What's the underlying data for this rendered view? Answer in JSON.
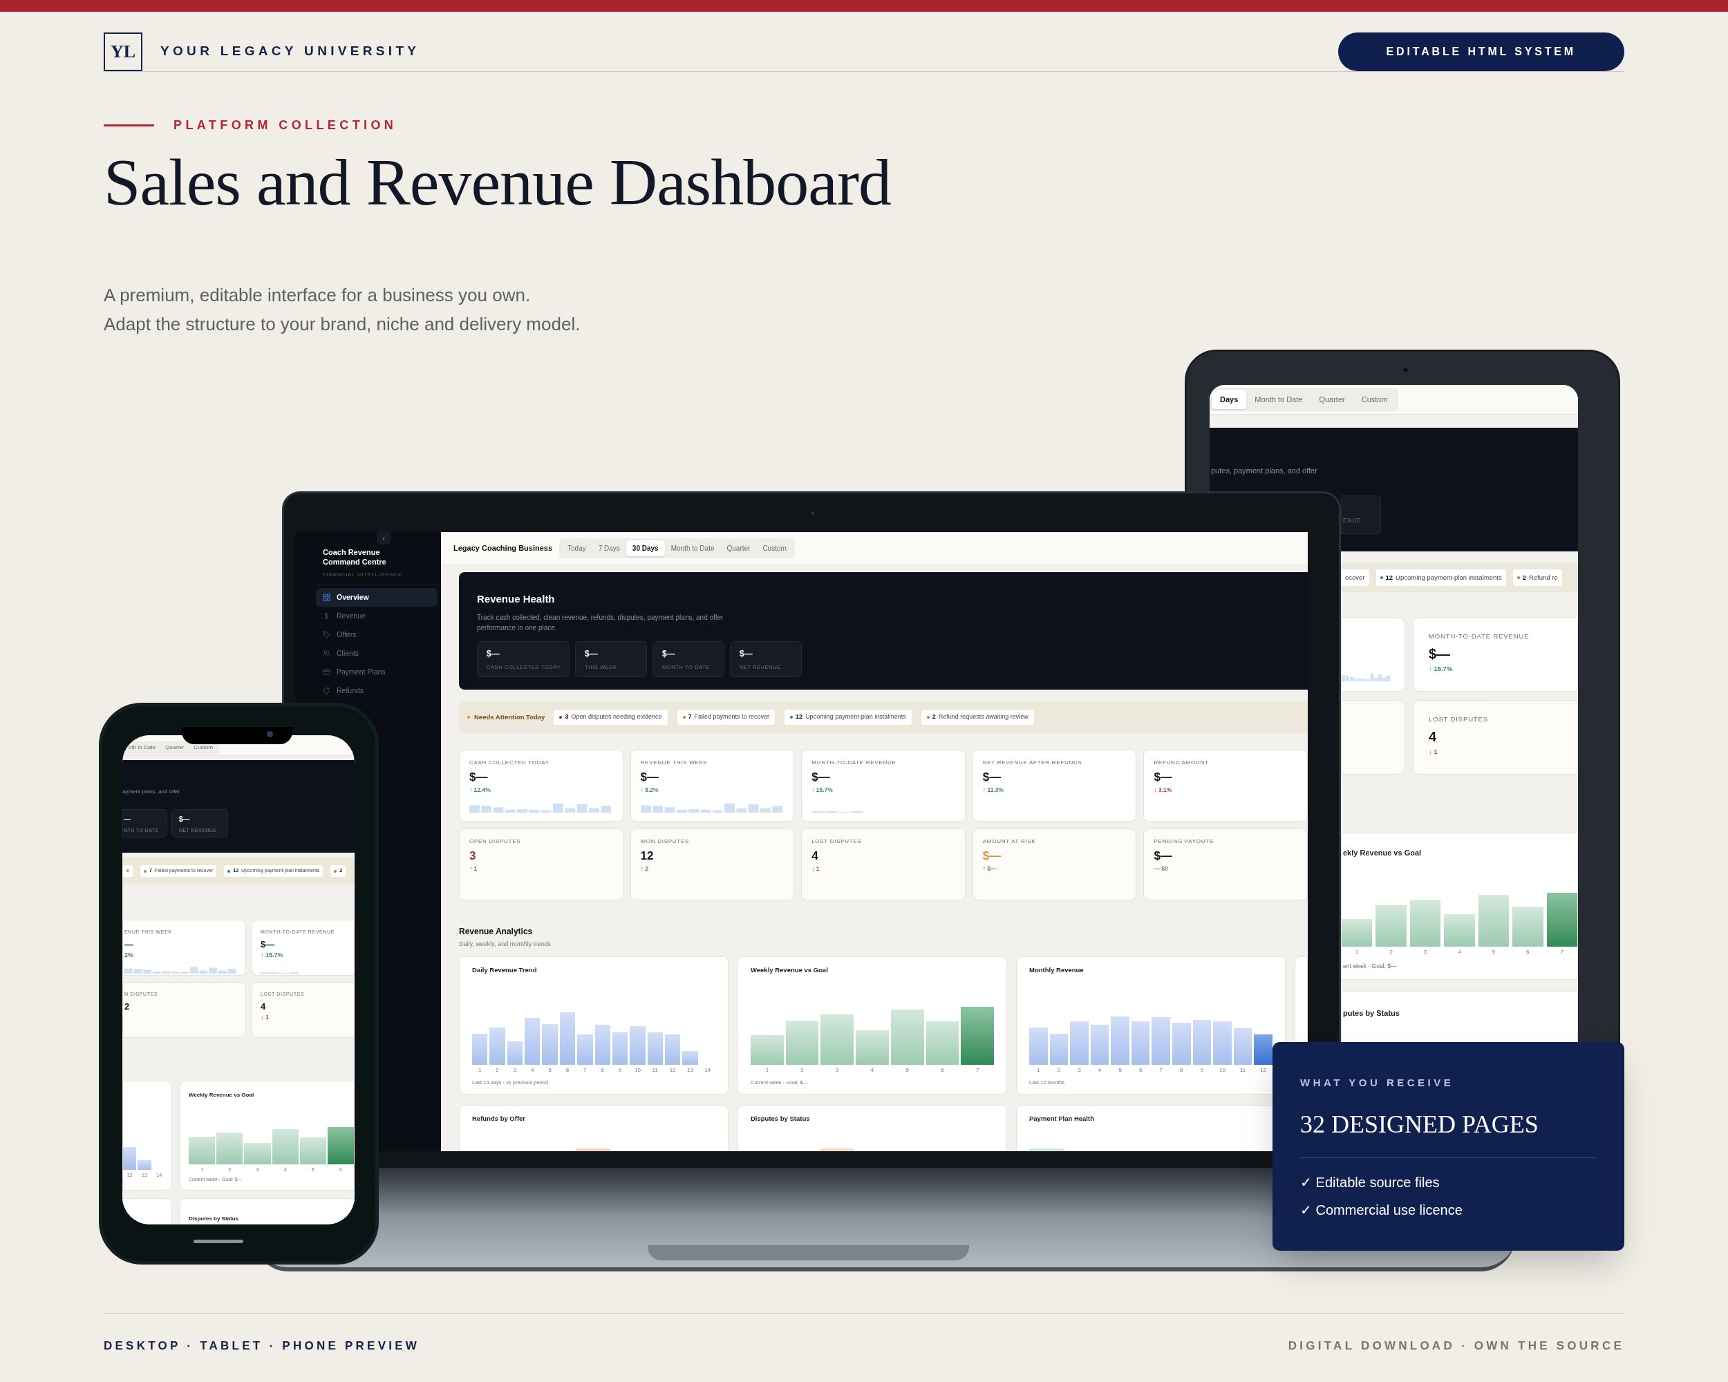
{
  "brand": {
    "logo": "YL",
    "name": "YOUR LEGACY UNIVERSITY",
    "cta": "EDITABLE HTML SYSTEM"
  },
  "intro": {
    "eyebrow": "PLATFORM COLLECTION",
    "title": "Sales and Revenue Dashboard",
    "lines": [
      "A premium, editable interface for a business you own.",
      "Adapt the structure to your brand, niche and delivery model."
    ]
  },
  "laptop": {
    "sidebar": {
      "title": "Coach Revenue Command Centre",
      "subtitle": "FINANCIAL INTELLIGENCE",
      "items": [
        {
          "label": "Overview",
          "selected": true
        },
        {
          "label": "Revenue",
          "selected": false
        },
        {
          "label": "Offers",
          "selected": false
        },
        {
          "label": "Clients",
          "selected": false
        },
        {
          "label": "Payment Plans",
          "selected": false
        },
        {
          "label": "Refunds",
          "selected": false
        }
      ]
    },
    "business": "Legacy Coaching Business",
    "ranges": [
      {
        "label": "Today",
        "selected": false
      },
      {
        "label": "7 Days",
        "selected": false
      },
      {
        "label": "30 Days",
        "selected": true
      },
      {
        "label": "Month to Date",
        "selected": false
      },
      {
        "label": "Quarter",
        "selected": false
      },
      {
        "label": "Custom",
        "selected": false
      }
    ],
    "health": {
      "title": "Revenue Health",
      "description": "Track cash collected, clean revenue, refunds, disputes, payment plans, and offer performance in one place.",
      "stats": [
        {
          "value": "$—",
          "label": "CASH COLLECTED TODAY"
        },
        {
          "value": "$—",
          "label": "THIS WEEK"
        },
        {
          "value": "$—",
          "label": "MONTH TO DATE"
        },
        {
          "value": "$—",
          "label": "NET REVENUE"
        }
      ]
    },
    "attention": {
      "label": "Needs Attention Today",
      "color": "#c59b3f",
      "items": [
        {
          "count": "3",
          "text": "Open disputes needing evidence",
          "color": "#9b2c2c"
        },
        {
          "count": "7",
          "text": "Failed payments to recover",
          "color": "#c0872f"
        },
        {
          "count": "12",
          "text": "Upcoming payment-plan instalments",
          "color": "#2f6fd0"
        },
        {
          "count": "2",
          "text": "Refund requests awaiting review",
          "color": "#a08a2a"
        }
      ]
    },
    "metrics": [
      {
        "kind": "bars",
        "label": "CASH COLLECTED TODAY",
        "value": {
          "text": "$—",
          "color": "#15171a"
        },
        "change": {
          "text": "↑ 12.4%",
          "color": "#3d8b62"
        }
      },
      {
        "kind": "bars",
        "label": "REVENUE THIS WEEK",
        "value": {
          "text": "$—",
          "color": "#15171a"
        },
        "change": {
          "text": "↑ 8.2%",
          "color": "#3d8b62"
        }
      },
      {
        "kind": "dashes",
        "label": "MONTH-TO-DATE REVENUE",
        "value": {
          "text": "$—",
          "color": "#15171a"
        },
        "change": {
          "text": "↑ 15.7%",
          "color": "#3d8b62"
        }
      },
      {
        "kind": "plain",
        "label": "NET REVENUE AFTER REFUNDS",
        "value": {
          "text": "$—",
          "color": "#15171a"
        },
        "change": {
          "text": "↑ 11.3%",
          "color": "#3d8b62"
        }
      },
      {
        "kind": "plain",
        "label": "REFUND AMOUNT",
        "value": {
          "text": "$—",
          "color": "#15171a"
        },
        "change": {
          "text": "↓ 3.1%",
          "color": "#b3453f"
        }
      },
      {
        "kind": "plain",
        "label": "OPEN DISPUTES",
        "value": {
          "text": "3",
          "color": "#a8322b"
        },
        "change": {
          "text": "↑ 1",
          "color": "#3d8b62"
        }
      },
      {
        "kind": "plain",
        "label": "WON DISPUTES",
        "value": {
          "text": "12",
          "color": "#15171a"
        },
        "change": {
          "text": "↑ 2",
          "color": "#3d8b62"
        }
      },
      {
        "kind": "plain",
        "label": "LOST DISPUTES",
        "value": {
          "text": "4",
          "color": "#15171a"
        },
        "change": {
          "text": "↓ 1",
          "color": "#b3453f"
        }
      },
      {
        "kind": "plain",
        "label": "AMOUNT AT RISK",
        "value": {
          "text": "$—",
          "color": "#c99a45"
        },
        "change": {
          "text": "↑ $—",
          "color": "#3d8b62"
        }
      },
      {
        "kind": "plain",
        "label": "PENDING PAYOUTS",
        "value": {
          "text": "$—",
          "color": "#15171a"
        },
        "change": {
          "text": "— $0",
          "color": "#7a7a7a"
        }
      }
    ],
    "analytics": {
      "title": "Revenue Analytics",
      "subtitle": "Daily, weekly, and monthly trends",
      "charts": [
        {
          "kind": "daily",
          "title": "Daily Revenue Trend",
          "x_labels": [
            "1",
            "2",
            "3",
            "4",
            "5",
            "6",
            "7",
            "8",
            "9",
            "10",
            "11",
            "12",
            "13",
            "14"
          ],
          "caption": "Last 14 days · vs previous period"
        },
        {
          "kind": "weekly",
          "title": "Weekly Revenue vs Goal",
          "x_labels": [
            "1",
            "2",
            "3",
            "4",
            "5",
            "6",
            "7"
          ],
          "caption": "Current week · Goal: $—"
        },
        {
          "kind": "monthly",
          "title": "Monthly Revenue",
          "x_labels": [
            "1",
            "2",
            "3",
            "4",
            "5",
            "6",
            "7",
            "8",
            "9",
            "10",
            "11",
            "12"
          ],
          "caption": "Last 12 months"
        }
      ],
      "more": [
        "Refunds by Offer",
        "Disputes by Status",
        "Payment Plan Health"
      ]
    }
  },
  "tablet": {
    "ranges": [
      {
        "label": "Days",
        "selected": true
      },
      {
        "label": "Month to Date",
        "selected": false
      },
      {
        "label": "Quarter",
        "selected": false
      },
      {
        "label": "Custom",
        "selected": false
      }
    ],
    "description": "putes, payment plans, and offer",
    "stat_label": "ENUE",
    "attention": [
      {
        "text": "ecover"
      },
      {
        "count": "12",
        "text": "Upcoming payment-plan instalments",
        "color": "#2f6fd0"
      },
      {
        "count": "2",
        "text": "Refund re",
        "color": "#a08a2a"
      }
    ],
    "metrics": [
      {
        "kind": "dashes",
        "label": "MONTH-TO-DATE REVENUE",
        "value": {
          "text": "$—",
          "color": "#15171a"
        },
        "change": {
          "text": "↑ 15.7%",
          "color": "#3d8b62"
        }
      },
      {
        "kind": "plain",
        "label": "LOST DISPUTES",
        "value": {
          "text": "4",
          "color": "#15171a"
        },
        "change": {
          "text": "↓ 1",
          "color": "#b3453f"
        }
      }
    ],
    "chart": {
      "kind": "weekly",
      "title": "ekly Revenue vs Goal",
      "x_labels": [
        "1",
        "2",
        "3",
        "4",
        "5",
        "6",
        "7"
      ],
      "caption": "ent week · Goal: $—"
    },
    "more": "putes by Status"
  },
  "phone": {
    "ranges": [
      {
        "label": "nth to Date",
        "selected": false
      },
      {
        "label": "Quarter",
        "selected": false
      },
      {
        "label": "Custom",
        "selected": false
      }
    ],
    "description": "ayment plans, and offer",
    "stats": [
      {
        "value": "—",
        "label": "NTH TO DATE"
      },
      {
        "value": "$—",
        "label": "NET REVENUE"
      }
    ],
    "attention": [
      {
        "text": "e"
      },
      {
        "count": "7",
        "text": "Failed payments to recover",
        "color": "#c0872f"
      },
      {
        "count": "12",
        "text": "Upcoming payment-plan instalments",
        "color": "#2f6fd0"
      },
      {
        "count": "2",
        "color": "#a08a2a"
      }
    ],
    "metrics": [
      {
        "kind": "bars",
        "label": "ENUE THIS WEEK",
        "value": {
          "text": "—",
          "color": "#15171a"
        },
        "change": {
          "text": "2%",
          "color": "#3d8b62"
        }
      },
      {
        "kind": "dashes",
        "label": "MONTH-TO-DATE REVENUE",
        "value": {
          "text": "$—",
          "color": "#15171a"
        },
        "change": {
          "text": "↑ 15.7%",
          "color": "#3d8b62"
        }
      },
      {
        "kind": "plain",
        "label": "N DISPUTES",
        "value": {
          "text": "2",
          "color": "#15171a"
        }
      },
      {
        "kind": "plain",
        "label": "LOST DISPUTES",
        "value": {
          "text": "4",
          "color": "#15171a"
        },
        "change": {
          "text": "↓ 1",
          "color": "#b3453f"
        }
      }
    ],
    "charts": [
      {
        "kind": "daily",
        "x_labels": [
          "12",
          "13",
          "14"
        ]
      },
      {
        "kind": "weekly",
        "title": "Weekly Revenue vs Goal",
        "x_labels": [
          "1",
          "2",
          "3",
          "4",
          "5",
          "6"
        ],
        "caption": "Current week · Goal: $—"
      }
    ],
    "more": "Disputes by Status"
  },
  "receive": {
    "eyebrow": "WHAT YOU RECEIVE",
    "title": "32 DESIGNED PAGES",
    "items": [
      "✓ Editable source files",
      "✓ Commercial use licence"
    ]
  },
  "footer": {
    "left": "DESKTOP · TABLET · PHONE PREVIEW",
    "right": "DIGITAL DOWNLOAD · OWN THE SOURCE"
  }
}
